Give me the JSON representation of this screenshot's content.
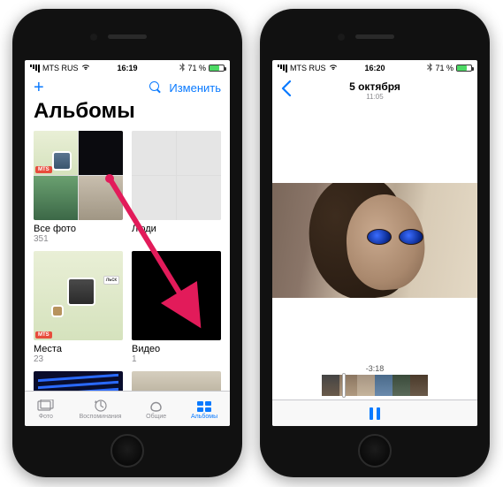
{
  "left": {
    "status": {
      "carrier": "MTS RUS",
      "wifi": true,
      "time": "16:19",
      "bt": true,
      "battery_pct": "71 %"
    },
    "nav": {
      "edit_label": "Изменить"
    },
    "title": "Альбомы",
    "albums": [
      {
        "title": "Все фото",
        "count": "351"
      },
      {
        "title": "Люди",
        "count": ""
      },
      {
        "title": "Места",
        "count": "23"
      },
      {
        "title": "Видео",
        "count": "1"
      }
    ],
    "tabs": [
      {
        "label": "Фото"
      },
      {
        "label": "Воспоминания"
      },
      {
        "label": "Общие"
      },
      {
        "label": "Альбомы"
      }
    ]
  },
  "right": {
    "status": {
      "carrier": "MTS RUS",
      "wifi": true,
      "time": "16:20",
      "bt": true,
      "battery_pct": "71 %"
    },
    "title": "5 октября",
    "subtitle": "11:05",
    "time_remaining": "-3:18"
  },
  "colors": {
    "accent": "#0a7aff",
    "arrow": "#e21b5a"
  }
}
